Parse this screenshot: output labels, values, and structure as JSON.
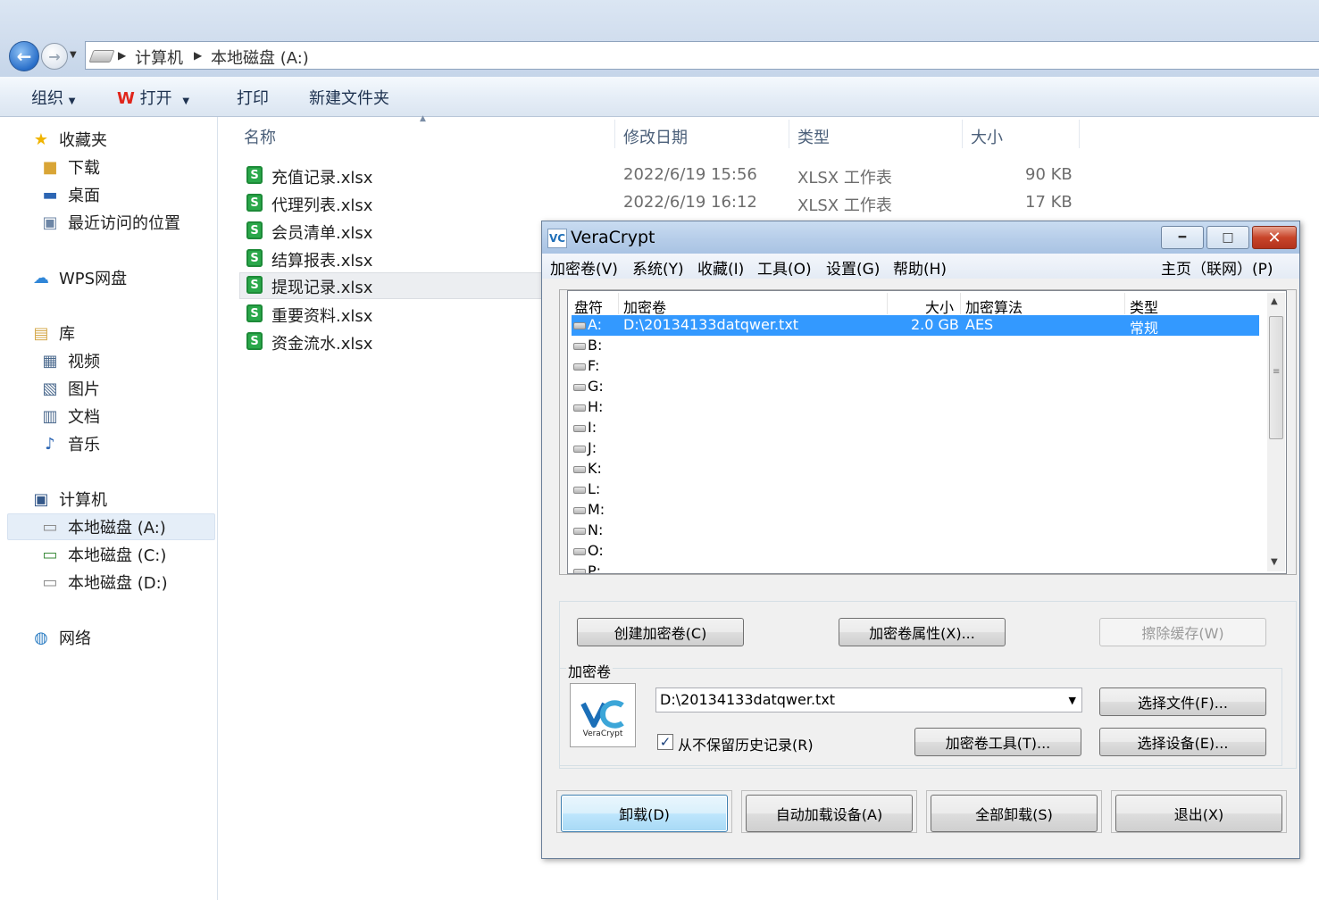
{
  "explorer": {
    "breadcrumbs": [
      "计算机",
      "本地磁盘 (A:)"
    ],
    "toolbar": {
      "organize": "组织",
      "open": "打开",
      "print": "打印",
      "new_folder": "新建文件夹"
    },
    "sidebar": {
      "favorites": "收藏夹",
      "downloads": "下载",
      "desktop": "桌面",
      "recent": "最近访问的位置",
      "wps_cloud": "WPS网盘",
      "libraries": "库",
      "videos": "视频",
      "pictures": "图片",
      "documents": "文档",
      "music": "音乐",
      "computer": "计算机",
      "drive_a": "本地磁盘 (A:)",
      "drive_c": "本地磁盘 (C:)",
      "drive_d": "本地磁盘 (D:)",
      "network": "网络"
    },
    "columns": {
      "name": "名称",
      "modified": "修改日期",
      "type": "类型",
      "size": "大小"
    },
    "files": [
      {
        "name": "充值记录.xlsx",
        "modified": "2022/6/19 15:56",
        "type": "XLSX 工作表",
        "size": "90 KB"
      },
      {
        "name": "代理列表.xlsx",
        "modified": "2022/6/19 16:12",
        "type": "XLSX 工作表",
        "size": "17 KB"
      },
      {
        "name": "会员清单.xlsx"
      },
      {
        "name": "结算报表.xlsx"
      },
      {
        "name": "提现记录.xlsx"
      },
      {
        "name": "重要资料.xlsx"
      },
      {
        "name": "资金流水.xlsx"
      }
    ]
  },
  "veracrypt": {
    "title": "VeraCrypt",
    "menu": [
      "加密卷(V)",
      "系统(Y)",
      "收藏(I)",
      "工具(O)",
      "设置(G)",
      "帮助(H)"
    ],
    "menu_right": "主页（联网）(P)",
    "list_headers": {
      "drive": "盘符",
      "volume": "加密卷",
      "size": "大小",
      "algorithm": "加密算法",
      "type": "类型"
    },
    "drives": [
      {
        "letter": "A:",
        "volume": "D:\\20134133datqwer.txt",
        "size": "2.0 GB",
        "algorithm": "AES",
        "type": "常规"
      },
      {
        "letter": "B:"
      },
      {
        "letter": "F:"
      },
      {
        "letter": "G:"
      },
      {
        "letter": "H:"
      },
      {
        "letter": "I:"
      },
      {
        "letter": "J:"
      },
      {
        "letter": "K:"
      },
      {
        "letter": "L:"
      },
      {
        "letter": "M:"
      },
      {
        "letter": "N:"
      },
      {
        "letter": "O:"
      },
      {
        "letter": "P:"
      }
    ],
    "buttons": {
      "create_volume": "创建加密卷(C)",
      "volume_properties": "加密卷属性(X)...",
      "wipe_cache": "擦除缓存(W)",
      "select_file": "选择文件(F)...",
      "volume_tools": "加密卷工具(T)...",
      "select_device": "选择设备(E)...",
      "dismount": "卸载(D)",
      "auto_mount": "自动加载设备(A)",
      "dismount_all": "全部卸载(S)",
      "exit": "退出(X)"
    },
    "volume_group_label": "加密卷",
    "volume_path": "D:\\20134133datqwer.txt",
    "never_save_history": "从不保留历史记录(R)",
    "never_save_history_checked": true,
    "logo_text": "VeraCrypt",
    "accent_color": "#3399ff"
  }
}
